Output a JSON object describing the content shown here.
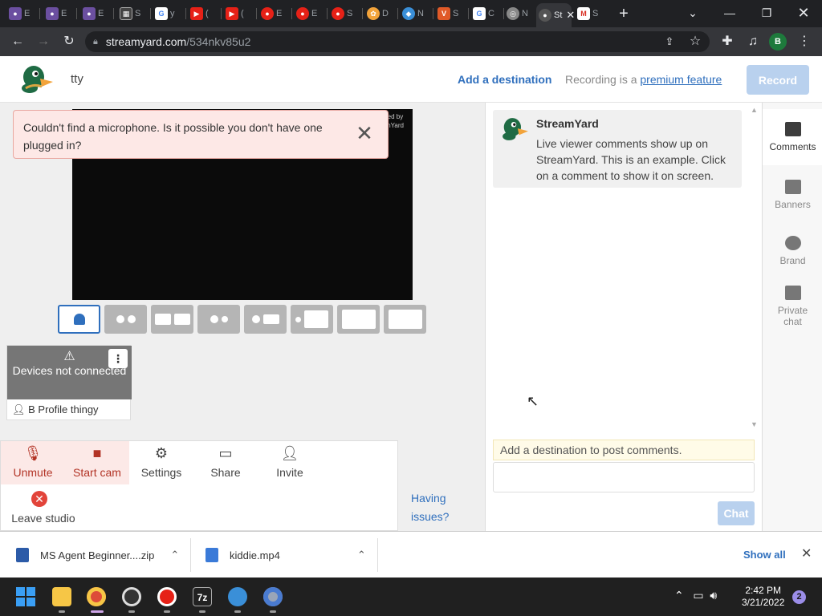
{
  "colors": {
    "accent": "#2f6fbd",
    "alert_bg": "#fde8e6",
    "danger": "#e2443a",
    "disabled": "#b9d1ee"
  },
  "browser": {
    "tabs": [
      {
        "label": "E",
        "icon": "hat-icon",
        "color": "#6b4fa0"
      },
      {
        "label": "E",
        "icon": "hat-icon",
        "color": "#6b4fa0"
      },
      {
        "label": "E",
        "icon": "hat-icon",
        "color": "#6b4fa0"
      },
      {
        "label": "S",
        "icon": "qr-icon",
        "color": "#444"
      },
      {
        "label": "y",
        "icon": "google-icon",
        "color": "#4285f4"
      },
      {
        "label": "(",
        "icon": "youtube-icon",
        "color": "#e62117"
      },
      {
        "label": "(",
        "icon": "youtube-icon",
        "color": "#e62117"
      },
      {
        "label": "E",
        "icon": "record-icon",
        "color": "#e62117"
      },
      {
        "label": "E",
        "icon": "record-icon",
        "color": "#e62117"
      },
      {
        "label": "S",
        "icon": "record-icon",
        "color": "#e62117"
      },
      {
        "label": "D",
        "icon": "colorful-icon",
        "color": "#f2a33a"
      },
      {
        "label": "N",
        "icon": "fish-icon",
        "color": "#3a8fd8"
      },
      {
        "label": "S",
        "icon": "v-icon",
        "color": "#e05a28"
      },
      {
        "label": "C",
        "icon": "google-icon",
        "color": "#4285f4"
      },
      {
        "label": "N",
        "icon": "chrome-icon",
        "color": "#888"
      },
      {
        "label": "St",
        "icon": "streamyard-icon",
        "color": "#555",
        "active": true
      },
      {
        "label": "S",
        "icon": "gmail-icon",
        "color": "#d93025"
      }
    ],
    "url_host": "streamyard.com",
    "url_path": "/534nkv85u2",
    "profile_initial": "B"
  },
  "header": {
    "broadcast_title": "tty",
    "add_destination": "Add a destination",
    "recording_prefix": "Recording is a",
    "premium_link": "premium feature",
    "record_button": "Record"
  },
  "alert": {
    "message": "Couldn't find a microphone. Is it possible you don't have one plugged in?"
  },
  "stage": {
    "watermark": "red by\nmYard"
  },
  "layouts": [
    {
      "name": "solo",
      "active": true
    },
    {
      "name": "two-up"
    },
    {
      "name": "group"
    },
    {
      "name": "thin-group"
    },
    {
      "name": "leader"
    },
    {
      "name": "side-by-side"
    },
    {
      "name": "picture-in-picture"
    },
    {
      "name": "screen-only"
    }
  ],
  "guest": {
    "status": "Devices not connected",
    "name": "B Profile thingy"
  },
  "controls": {
    "unmute": "Unmute",
    "start_cam": "Start cam",
    "settings": "Settings",
    "share": "Share",
    "invite": "Invite",
    "leave": "Leave studio",
    "issues": "Having issues?"
  },
  "chat": {
    "comment_author": "StreamYard",
    "comment_text": "Live viewer comments show up on StreamYard. This is an example. Click on a comment to show it on screen.",
    "destination_notice": "Add a destination to post comments.",
    "chat_button": "Chat"
  },
  "side_nav": [
    {
      "label": "Comments",
      "active": true
    },
    {
      "label": "Banners"
    },
    {
      "label": "Brand"
    },
    {
      "label": "Private chat"
    }
  ],
  "downloads": {
    "item1": "MS Agent Beginner....zip",
    "item2": "kiddie.mp4",
    "show_all": "Show all"
  },
  "taskbar": {
    "time": "2:42 PM",
    "date": "3/21/2022",
    "notifications": "2"
  }
}
